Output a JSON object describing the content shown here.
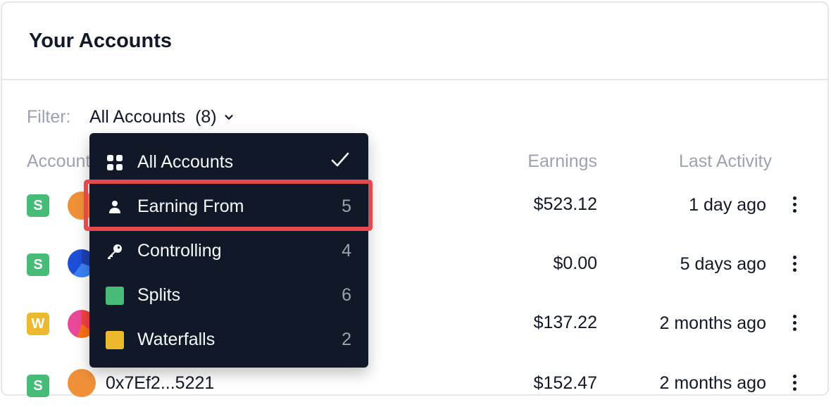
{
  "title": "Your Accounts",
  "filter": {
    "label": "Filter:",
    "value": "All Accounts  (8)"
  },
  "columns": {
    "account": "Accounts",
    "earnings": "Earnings",
    "last_activity": "Last Activity"
  },
  "rows": [
    {
      "badge": "S",
      "badge_color": "#48bb78",
      "earnings": "$523.12",
      "last_activity": "1 day ago"
    },
    {
      "badge": "S",
      "badge_color": "#48bb78",
      "earnings": "$0.00",
      "last_activity": "5 days ago"
    },
    {
      "badge": "W",
      "badge_color": "#ecb92f",
      "earnings": "$137.22",
      "last_activity": "2 months ago"
    },
    {
      "badge": "S",
      "badge_color": "#48bb78",
      "name": "0x7Ef2...5221",
      "earnings": "$152.47",
      "last_activity": "2 months ago"
    }
  ],
  "menu": {
    "items": [
      {
        "label": "All Accounts",
        "icon": "grid-icon",
        "selected": true
      },
      {
        "label": "Earning From",
        "icon": "person-icon",
        "count": "5"
      },
      {
        "label": "Controlling",
        "icon": "key-icon",
        "count": "4"
      },
      {
        "label": "Splits",
        "icon": "green-square-icon",
        "count": "6",
        "color": "#48bb78"
      },
      {
        "label": "Waterfalls",
        "icon": "yellow-square-icon",
        "count": "2",
        "color": "#ecb92f"
      }
    ]
  },
  "colors": {
    "menu_bg": "#111827",
    "highlight": "#e5484d",
    "splits": "#48bb78",
    "waterfalls": "#ecb92f"
  }
}
